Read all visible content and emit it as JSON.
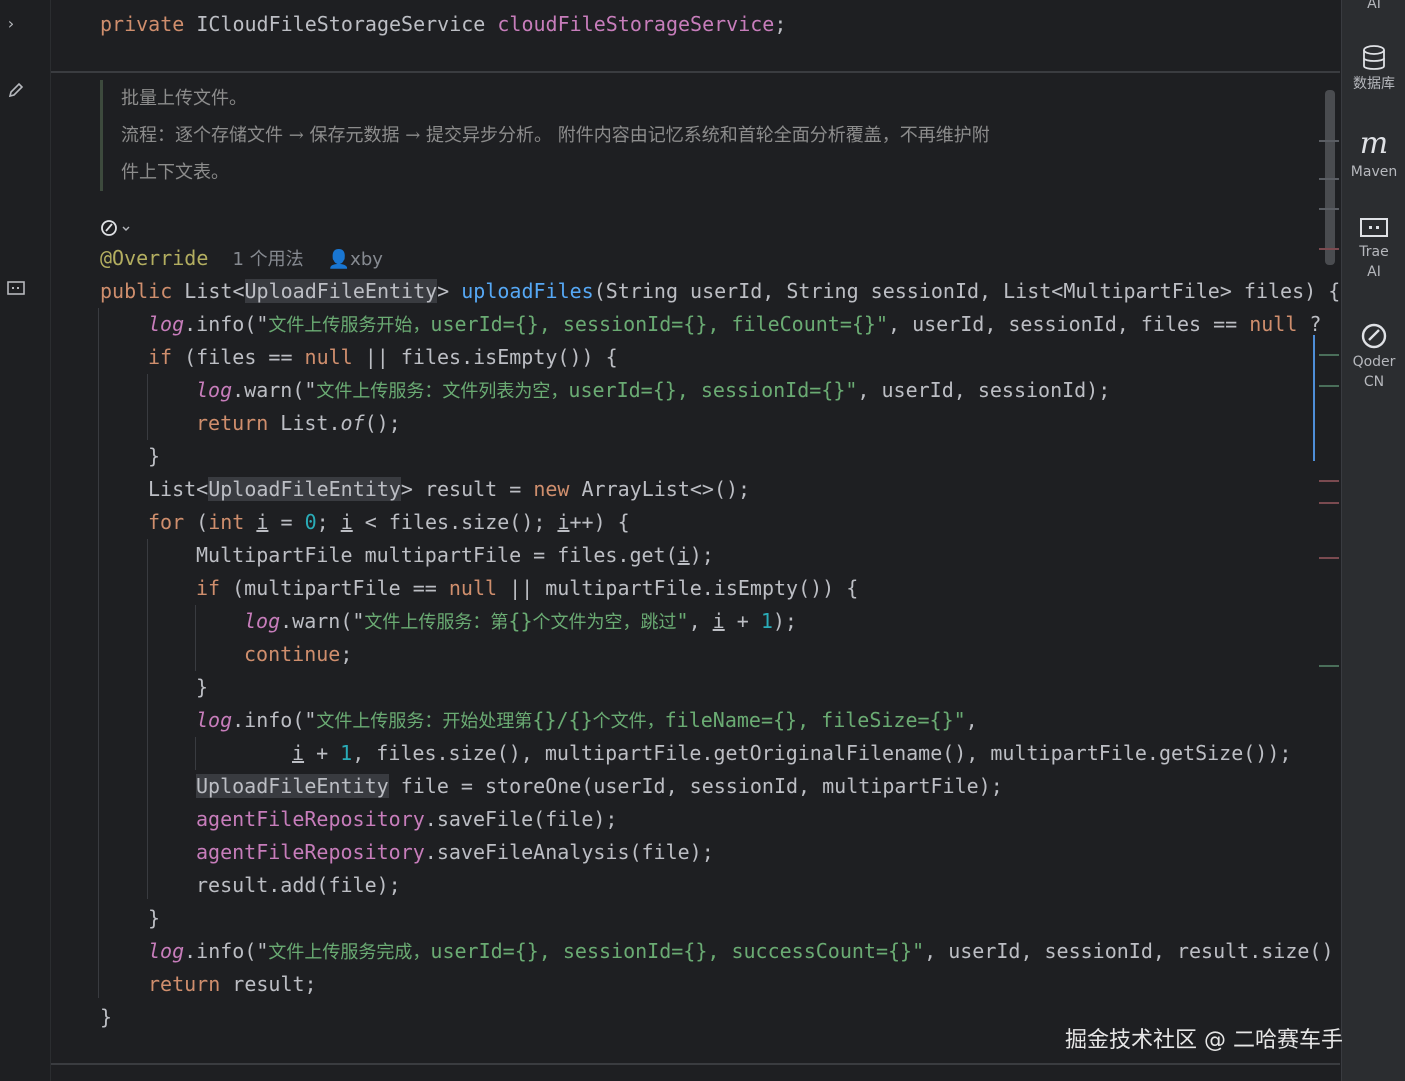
{
  "editor": {
    "field_line": {
      "kw": "private",
      "type": "ICloudFileStorageService",
      "name": "cloudFileStorageService",
      "end": ";"
    },
    "javadoc": {
      "line1": "批量上传文件。",
      "line2": "流程：逐个存储文件 → 保存元数据 → 提交异步分析。 附件内容由记忆系统和首轮全面分析覆盖，不再维护附",
      "line3": "件上下文表。"
    },
    "annotation": "@Override",
    "usage_hint": "1 个用法",
    "author_hint": "xby",
    "signature": {
      "kw": "public",
      "ret": "List<",
      "ret_type": "UploadFileEntity",
      "ret_end": ">",
      "name": "uploadFiles",
      "params": "(String userId, String sessionId, List<MultipartFile> files) {"
    },
    "lines": {
      "l1_log": "log",
      "l1_call": ".info(\"",
      "l1_str": "文件上传服务开始，",
      "l1_rest": "userId={}, sessionId={}, fileCount={}\"",
      "l1_tail": ", userId, sessionId, files == ",
      "l1_null": "null",
      "l1_q": " ?",
      "l2_if": "if",
      "l2_a": " (files == ",
      "l2_null": "null",
      "l2_b": " || files.isEmpty()) {",
      "l3_log": "log",
      "l3_call": ".warn(\"",
      "l3_str": "文件上传服务：文件列表为空，",
      "l3_rest": "userId={}, sessionId={}\"",
      "l3_tail": ", userId, sessionId);",
      "l4_ret": "return",
      "l4_a": " List.",
      "l4_of": "of",
      "l4_b": "();",
      "l5": "}",
      "l6_a": "List<",
      "l6_type": "UploadFileEntity",
      "l6_b": "> result = ",
      "l6_new": "new",
      "l6_c": " ArrayList<>();",
      "l7_for": "for",
      "l7_a": " (",
      "l7_int": "int",
      "l7_i1": "i",
      "l7_b": " = ",
      "l7_zero": "0",
      "l7_c": "; ",
      "l7_i2": "i",
      "l7_d": " < files.size(); ",
      "l7_i3": "i",
      "l7_e": "++) {",
      "l8_a": "MultipartFile multipartFile = files.get(",
      "l8_i": "i",
      "l8_b": ");",
      "l9_if": "if",
      "l9_a": " (multipartFile == ",
      "l9_null": "null",
      "l9_b": " || multipartFile.isEmpty()) {",
      "l10_log": "log",
      "l10_call": ".warn(\"",
      "l10_str1": "文件上传服务：第",
      "l10_ph": "{}",
      "l10_str2": "个文件为空，跳过",
      "l10_q": "\"",
      "l10_c": ", ",
      "l10_i": "i",
      "l10_d": " + ",
      "l10_one": "1",
      "l10_e": ");",
      "l11_cont": "continue",
      "l11_e": ";",
      "l12": "}",
      "l13_log": "log",
      "l13_call": ".info(\"",
      "l13_str1": "文件上传服务：开始处理第",
      "l13_ph": "{}/{}",
      "l13_str2": "个文件，",
      "l13_rest": "fileName={}, fileSize={}\"",
      "l13_e": ",",
      "l14_i": "i",
      "l14_a": " + ",
      "l14_one": "1",
      "l14_b": ", files.size(), multipartFile.getOriginalFilename(), multipartFile.getSize());",
      "l15_type": "UploadFileEntity",
      "l15_a": " file = storeOne(userId, sessionId, multipartFile);",
      "l16_field": "agentFileRepository",
      "l16_a": ".saveFile(file);",
      "l17_field": "agentFileRepository",
      "l17_a": ".saveFileAnalysis(file);",
      "l18": "result.add(file);",
      "l19": "}",
      "l20_log": "log",
      "l20_call": ".info(\"",
      "l20_str": "文件上传服务完成，",
      "l20_rest": "userId={}, sessionId={}, successCount={}\"",
      "l20_tail": ", userId, sessionId, result.size()",
      "l21_ret": "return",
      "l21_a": " result;",
      "l22": "}"
    }
  },
  "right_toolbar": {
    "top_label": "AI",
    "items": [
      {
        "label": "数据库"
      },
      {
        "label": "Maven"
      },
      {
        "label": "Trae AI"
      },
      {
        "label": "Qoder CN"
      }
    ]
  },
  "watermark": "掘金技术社区 @ 二哈赛车手",
  "colors": {
    "keyword": "#cf8e6d",
    "function": "#56a8f5",
    "string": "#6aab73",
    "number": "#2aacb8",
    "field": "#c77dbb",
    "annotation": "#b3ae60",
    "background": "#1e1f22"
  }
}
